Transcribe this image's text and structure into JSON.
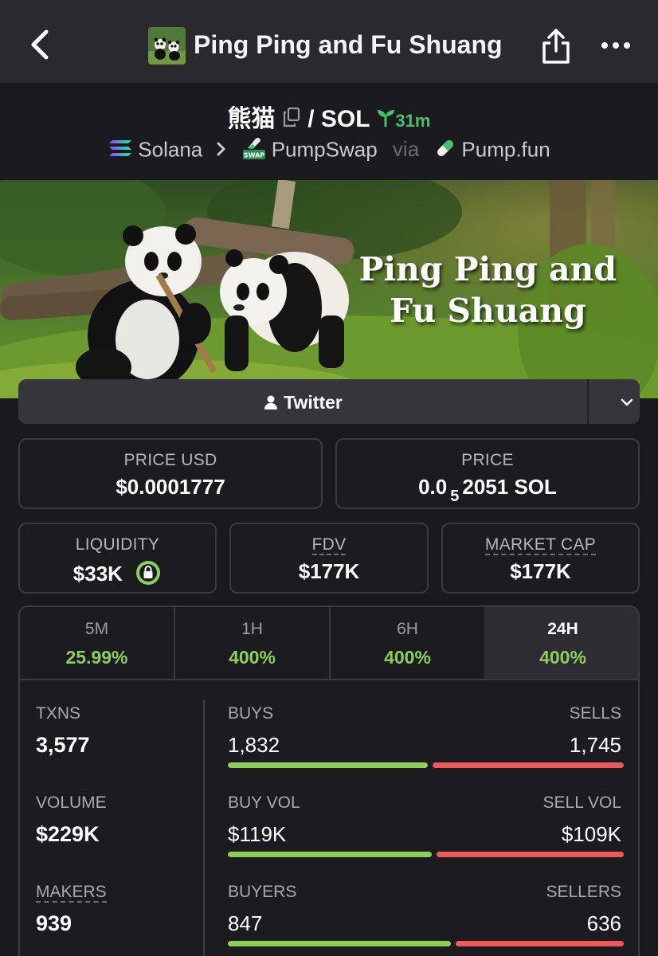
{
  "header": {
    "title": "Ping Ping and Fu Shuang",
    "back_icon": "chevron-left-icon",
    "share_icon": "share-icon",
    "more_icon": "more-icon"
  },
  "pair": {
    "base": "熊猫",
    "separator": "/",
    "quote": "SOL",
    "age": "31m"
  },
  "chain": {
    "network": "Solana",
    "dex": "PumpSwap",
    "via": "via",
    "launchpad": "Pump.fun"
  },
  "banner": {
    "line1": "Ping Ping and",
    "line2": "Fu Shuang"
  },
  "social": {
    "twitter_label": "Twitter"
  },
  "price": {
    "usd_label": "PRICE USD",
    "usd_value": "$0.0001777",
    "native_label": "PRICE",
    "native_prefix": "0.0",
    "native_zeros": "5",
    "native_rest": "2051 SOL"
  },
  "metrics": {
    "liquidity_label": "LIQUIDITY",
    "liquidity_value": "$33K",
    "fdv_label": "FDV",
    "fdv_value": "$177K",
    "mcap_label": "MARKET CAP",
    "mcap_value": "$177K"
  },
  "timeframes": [
    {
      "label": "5M",
      "change": "25.99%"
    },
    {
      "label": "1H",
      "change": "400%"
    },
    {
      "label": "6H",
      "change": "400%"
    },
    {
      "label": "24H",
      "change": "400%"
    }
  ],
  "active_timeframe": "24H",
  "stats": {
    "txns_label": "TXNS",
    "txns_value": "3,577",
    "volume_label": "VOLUME",
    "volume_value": "$229K",
    "makers_label": "MAKERS",
    "makers_value": "939",
    "buys_label": "BUYS",
    "buys_value": "1,832",
    "sells_label": "SELLS",
    "sells_value": "1,745",
    "buyvol_label": "BUY VOL",
    "buyvol_value": "$119K",
    "sellvol_label": "SELL VOL",
    "sellvol_value": "$109K",
    "buyers_label": "BUYERS",
    "buyers_value": "847",
    "sellers_label": "SELLERS",
    "sellers_value": "636",
    "buys_ratio": 0.512,
    "buyvol_ratio": 0.522,
    "buyers_ratio": 0.571
  },
  "colors": {
    "positive": "#8ccf5a",
    "negative": "#ec5a5a",
    "age": "#46c26a"
  }
}
